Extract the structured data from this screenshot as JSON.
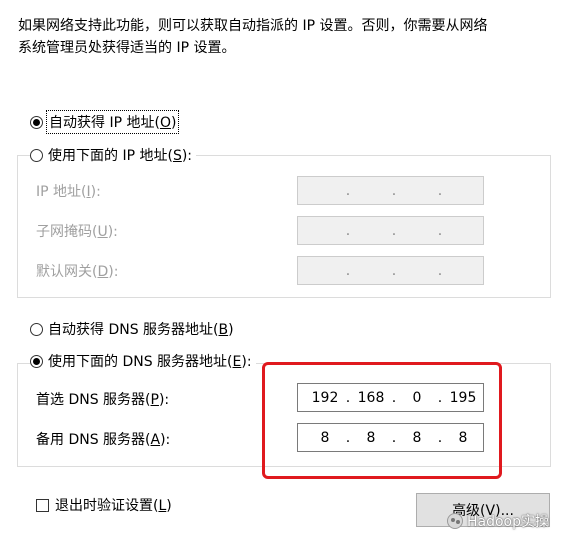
{
  "description": {
    "line1": "如果网络支持此功能，则可以获取自动指派的 IP 设置。否则，你需要从网络",
    "line2": "系统管理员处获得适当的 IP 设置。"
  },
  "ip_section": {
    "auto_ip": {
      "label": "自动获得 IP 地址(",
      "accel": "O",
      "suffix": ")",
      "selected": true
    },
    "manual_ip": {
      "label": "使用下面的 IP 地址(",
      "accel": "S",
      "suffix": "):",
      "selected": false,
      "fields": [
        {
          "label": "IP 地址(",
          "accel": "I",
          "suffix": "):",
          "octets": [
            "",
            "",
            "",
            ""
          ]
        },
        {
          "label": "子网掩码(",
          "accel": "U",
          "suffix": "):",
          "octets": [
            "",
            "",
            "",
            ""
          ]
        },
        {
          "label": "默认网关(",
          "accel": "D",
          "suffix": "):",
          "octets": [
            "",
            "",
            "",
            ""
          ]
        }
      ]
    }
  },
  "dns_section": {
    "auto_dns": {
      "label": "自动获得 DNS 服务器地址(",
      "accel": "B",
      "suffix": ")",
      "selected": false
    },
    "manual_dns": {
      "label": "使用下面的 DNS 服务器地址(",
      "accel": "E",
      "suffix": "):",
      "selected": true,
      "preferred": {
        "label": "首选 DNS 服务器(",
        "accel": "P",
        "suffix": "):",
        "octets": [
          "192",
          "168",
          "0",
          "195"
        ]
      },
      "alternate": {
        "label": "备用 DNS 服务器(",
        "accel": "A",
        "suffix": "):",
        "octets": [
          "8",
          "8",
          "8",
          "8"
        ]
      }
    }
  },
  "validate_on_exit": {
    "label": "退出时验证设置(",
    "accel": "L",
    "suffix": ")",
    "checked": false
  },
  "advanced_button": {
    "label": "高级(V)..."
  },
  "watermark": {
    "text": "Hadoop实操"
  },
  "colors": {
    "highlight": "#e0191e",
    "disabled_text": "#a0a0a0"
  }
}
